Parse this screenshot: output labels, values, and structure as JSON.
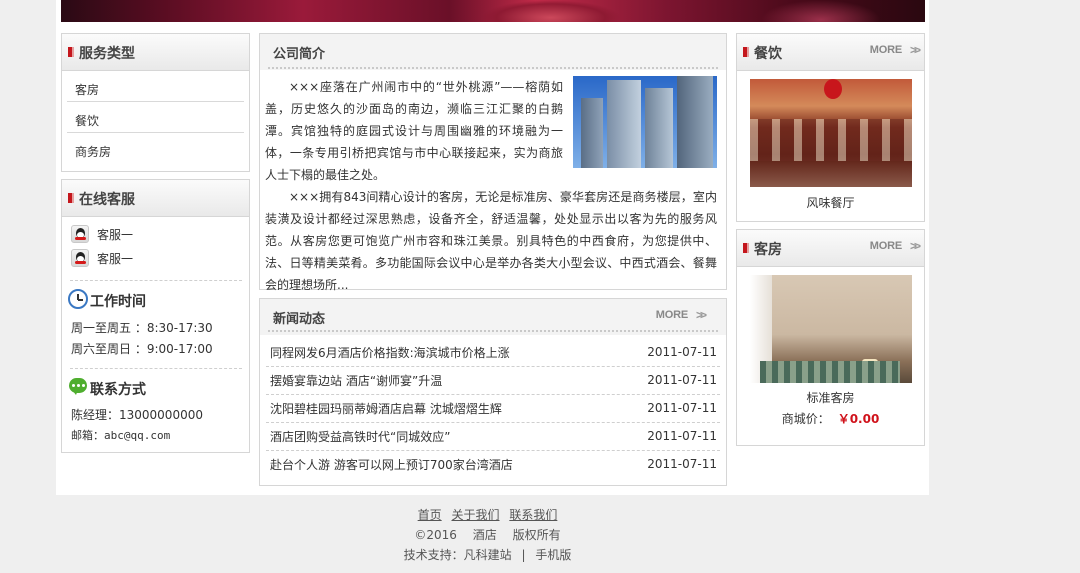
{
  "service_types": {
    "title": "服务类型",
    "items": [
      "客房",
      "餐饮",
      "商务房"
    ]
  },
  "online_service": {
    "title": "在线客服",
    "agents": [
      "客服一",
      "客服一"
    ],
    "hours_title": "工作时间",
    "hours": [
      "周一至周五 ：8:30-17:30",
      "周六至周日 ：9:00-17:00"
    ],
    "contact_title": "联系方式",
    "manager": "陈经理：13000000000",
    "email": "邮箱：abc@qq.com"
  },
  "intro": {
    "title": "公司简介",
    "para1": "×××座落在广州闹市中的“世外桃源”——榕荫如盖，历史悠久的沙面岛的南边，濒临三江汇聚的白鹅潭。宾馆独特的庭园式设计与周围幽雅的环境融为一体，一条专用引桥把宾馆与市中心联接起来，实为商旅人士下榻的最佳之处。",
    "para2": "×××拥有843间精心设计的客房，无论是标准房、豪华套房还是商务楼层，室内装潢及设计都经过深思熟虑，设备齐全，舒适温馨，处处显示出以客为先的服务风范。从客房您更可饱览广州市容和珠江美景。别具特色的中西食府，为您提供中、法、日等精美菜肴。多功能国际会议中心是举办各类大小型会议、中西式酒会、餐舞会的理想场所..."
  },
  "news": {
    "title": "新闻动态",
    "more": "MORE",
    "items": [
      {
        "title": "同程网发6月酒店价格指数:海滨城市价格上涨",
        "date": "2011-07-11"
      },
      {
        "title": "摆婚宴靠边站 酒店“谢师宴”升温",
        "date": "2011-07-11"
      },
      {
        "title": "沈阳碧桂园玛丽蒂姆酒店启幕 沈城熠熠生辉",
        "date": "2011-07-11"
      },
      {
        "title": "酒店团购受益高铁时代“同城效应”",
        "date": "2011-07-11"
      },
      {
        "title": "赴台个人游 游客可以网上预订700家台湾酒店",
        "date": "2011-07-11"
      }
    ]
  },
  "dining": {
    "title": "餐饮",
    "more": "MORE",
    "caption": "风味餐厅"
  },
  "rooms": {
    "title": "客房",
    "more": "MORE",
    "caption": "标准客房",
    "price_label": "商城价：",
    "price_value": "￥0.00"
  },
  "footer": {
    "links": [
      "首页",
      "关于我们",
      "联系我们"
    ],
    "copyright_year": "©2016",
    "site_name": "酒店",
    "rights": "版权所有",
    "support_label": "技术支持：凡科建站",
    "divider": "|",
    "mobile": "手机版"
  },
  "colors": {
    "accent_red": "#c4161c",
    "price_red": "#d0121b"
  },
  "icons": [
    "qq-icon",
    "clock-icon",
    "chat-icon",
    "more-arrow-icon"
  ]
}
